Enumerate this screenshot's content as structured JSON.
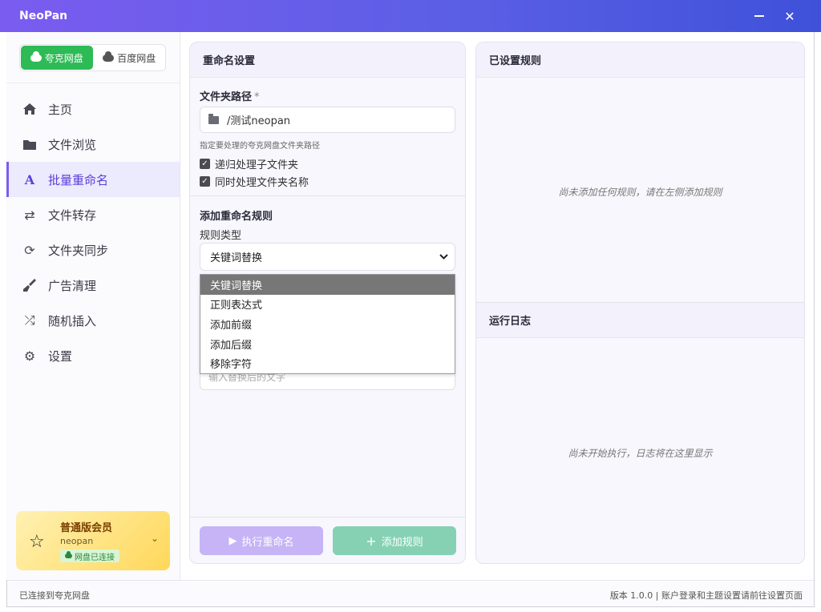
{
  "window": {
    "title": "NeoPan"
  },
  "sidebar": {
    "drive_tabs": [
      {
        "label": "夸克网盘",
        "active": true
      },
      {
        "label": "百度网盘",
        "active": false
      }
    ],
    "nav": [
      {
        "label": "主页",
        "icon": "home-icon"
      },
      {
        "label": "文件浏览",
        "icon": "folder-icon"
      },
      {
        "label": "批量重命名",
        "icon": "rename-icon",
        "active": true
      },
      {
        "label": "文件转存",
        "icon": "transfer-icon"
      },
      {
        "label": "文件夹同步",
        "icon": "sync-icon"
      },
      {
        "label": "广告清理",
        "icon": "broom-icon"
      },
      {
        "label": "随机插入",
        "icon": "shuffle-icon"
      },
      {
        "label": "设置",
        "icon": "gear-icon"
      }
    ],
    "member": {
      "title": "普通版会员",
      "username": "neopan",
      "status": "网盘已连接"
    }
  },
  "rename": {
    "header": "重命名设置",
    "folder_label": "文件夹路径",
    "required_mark": "*",
    "folder_value": "/测试neopan",
    "hint": "指定要处理的夸克网盘文件夹路径",
    "recursive_label": "递归处理子文件夹",
    "include_folders_label": "同时处理文件夹名称",
    "add_rule_title": "添加重命名规则",
    "rule_type_label": "规则类型",
    "rule_type_value": "关键词替换",
    "rule_options": [
      "关键词替换",
      "正则表达式",
      "添加前缀",
      "添加后缀",
      "移除字符"
    ],
    "replace_placeholder": "输入替换后的文字",
    "run_button": "执行重命名",
    "add_button": "添加规则"
  },
  "rules": {
    "header": "已设置规则",
    "empty": "尚未添加任何规则，请在左侧添加规则"
  },
  "log": {
    "header": "运行日志",
    "empty": "尚未开始执行，日志将在这里显示"
  },
  "statusbar": {
    "left": "已连接到夸克网盘",
    "right": "版本 1.0.0 | 账户登录和主题设置请前往设置页面"
  },
  "colors": {
    "accent": "#7c5cf2",
    "quark_green": "#2dbb55",
    "run_button": "#c6b4f7",
    "add_button": "#86d1b3"
  }
}
